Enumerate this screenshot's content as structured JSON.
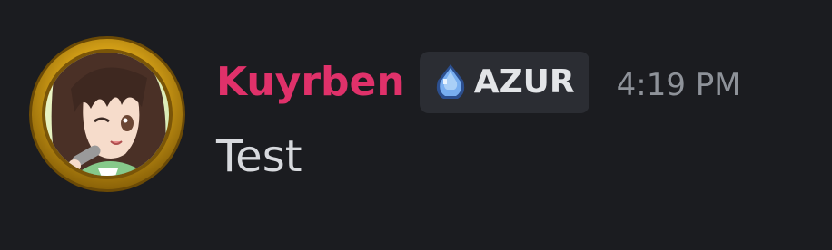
{
  "message": {
    "author": {
      "name": "Kuyrben",
      "name_color": "#e0316a",
      "avatar": "anime-girl-avatar-gold-frame"
    },
    "tag": {
      "icon": "blue-gem-icon",
      "label": "AZUR"
    },
    "timestamp": "4:19 PM",
    "content": "Test"
  },
  "colors": {
    "background": "#1b1c20",
    "tag_background": "#2b2d33",
    "timestamp": "#8e9299",
    "text": "#d7d9dd",
    "avatar_frame": "#d4a017"
  }
}
